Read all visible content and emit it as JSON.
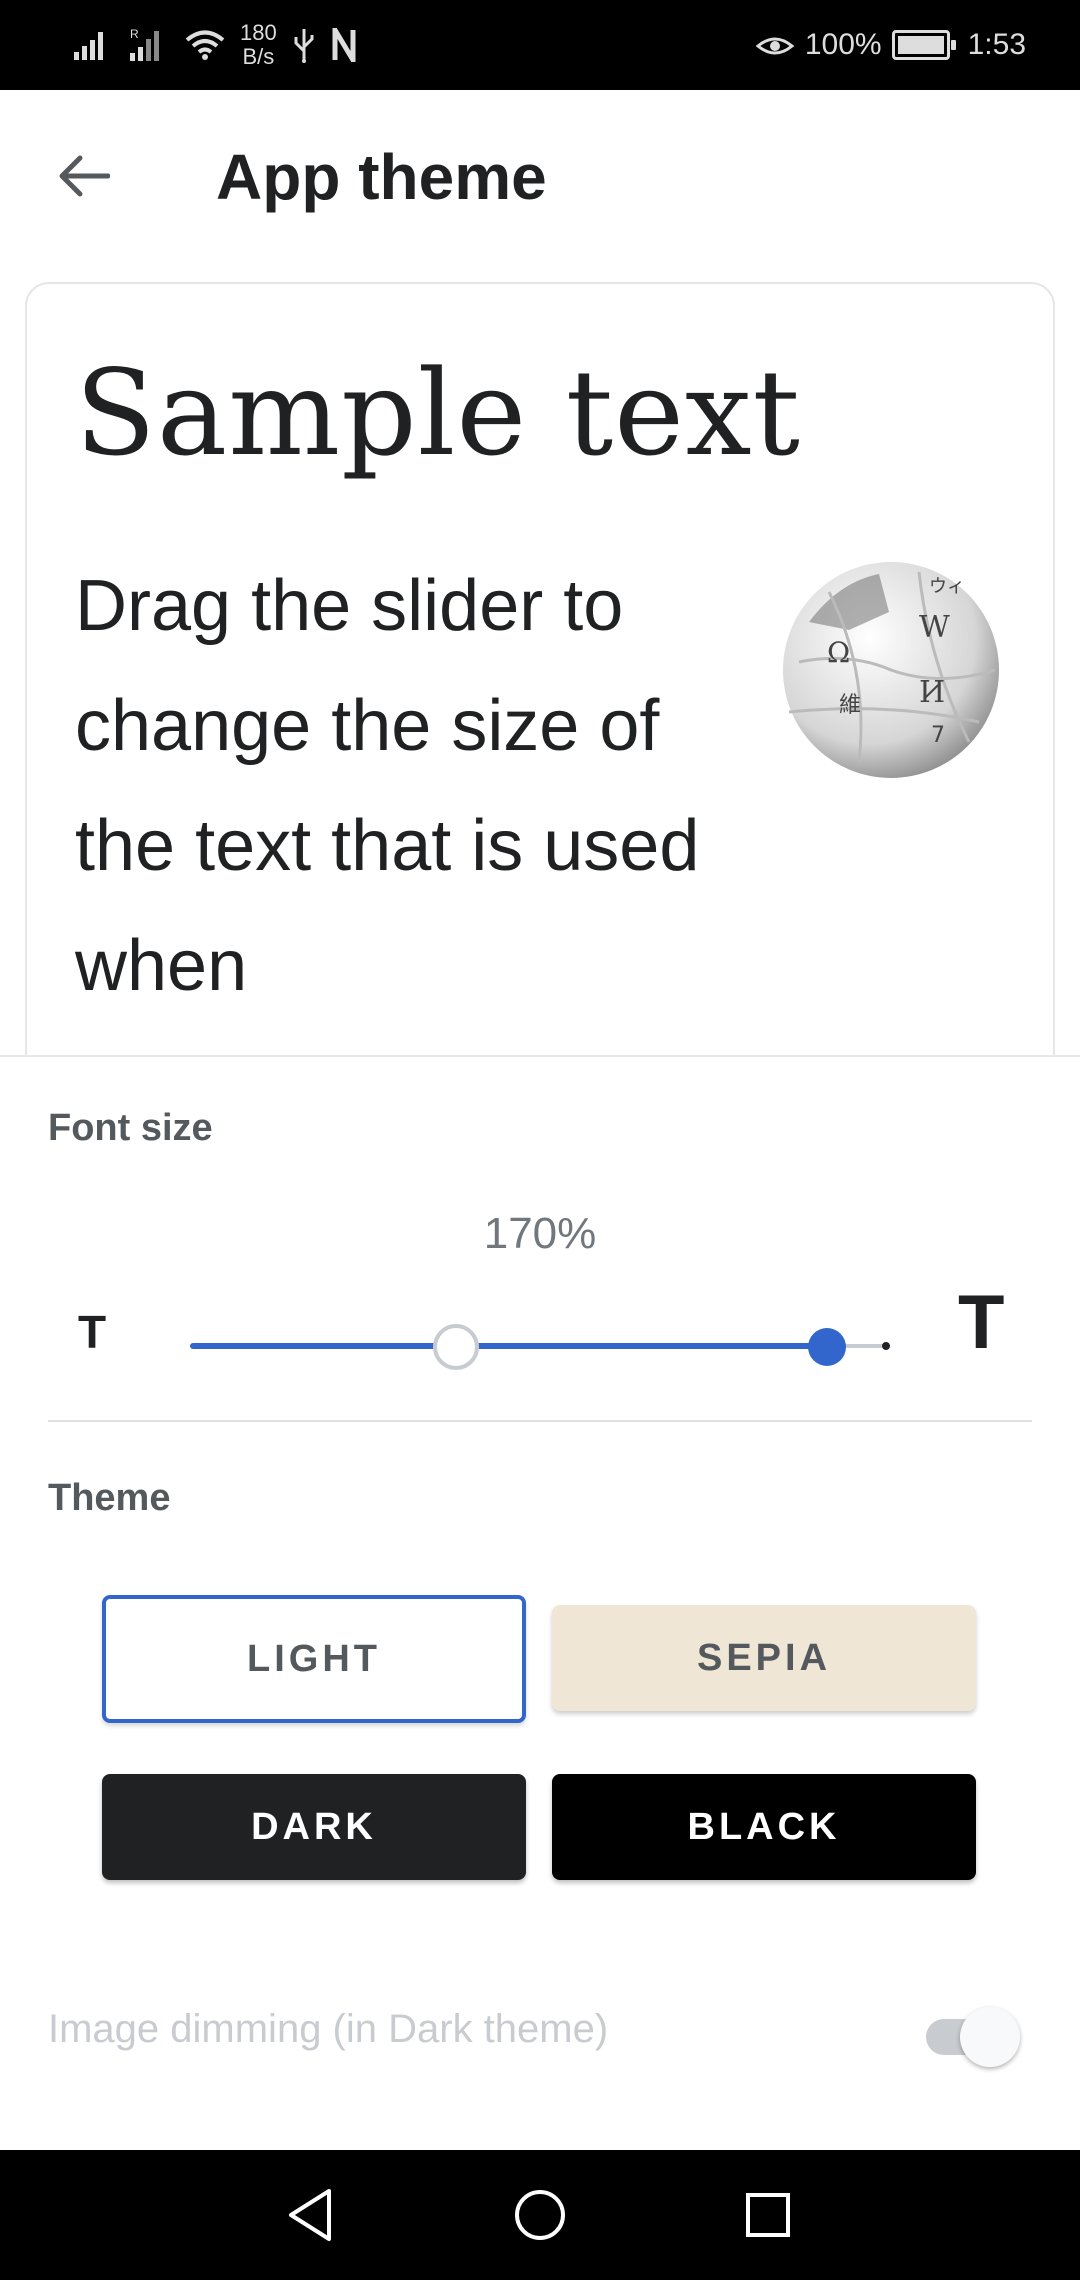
{
  "status_bar": {
    "net_speed_value": "180",
    "net_speed_unit": "B/s",
    "battery": "100%",
    "time": "1:53",
    "icons": [
      "signal-icon",
      "signal-roaming-icon",
      "wifi-icon",
      "usb-icon",
      "n-icon",
      "eye-comfort-icon",
      "battery-icon"
    ]
  },
  "app_bar": {
    "title": "App theme",
    "back_icon": "arrow-left-icon"
  },
  "preview": {
    "title": "Sample text",
    "body": "Drag the slider to change the size of the text that is used when",
    "image": "wikipedia-globe-logo"
  },
  "font_size": {
    "label": "Font size",
    "value": "170%",
    "small_label": "T",
    "large_label": "T",
    "slider_fraction": 0.91,
    "default_fraction": 0.38
  },
  "theme": {
    "label": "Theme",
    "options": [
      {
        "label": "LIGHT",
        "selected": true
      },
      {
        "label": "SEPIA",
        "selected": false
      },
      {
        "label": "DARK",
        "selected": false
      },
      {
        "label": "BLACK",
        "selected": false
      }
    ]
  },
  "image_dimming": {
    "label": "Image dimming (in Dark theme)",
    "enabled": true
  },
  "colors": {
    "accent": "#3366cc",
    "sepia": "#f0e6d6",
    "dark": "#202122",
    "black": "#000000"
  },
  "nav_bar": {
    "icons": [
      "nav-back-icon",
      "nav-home-icon",
      "nav-recents-icon"
    ]
  }
}
